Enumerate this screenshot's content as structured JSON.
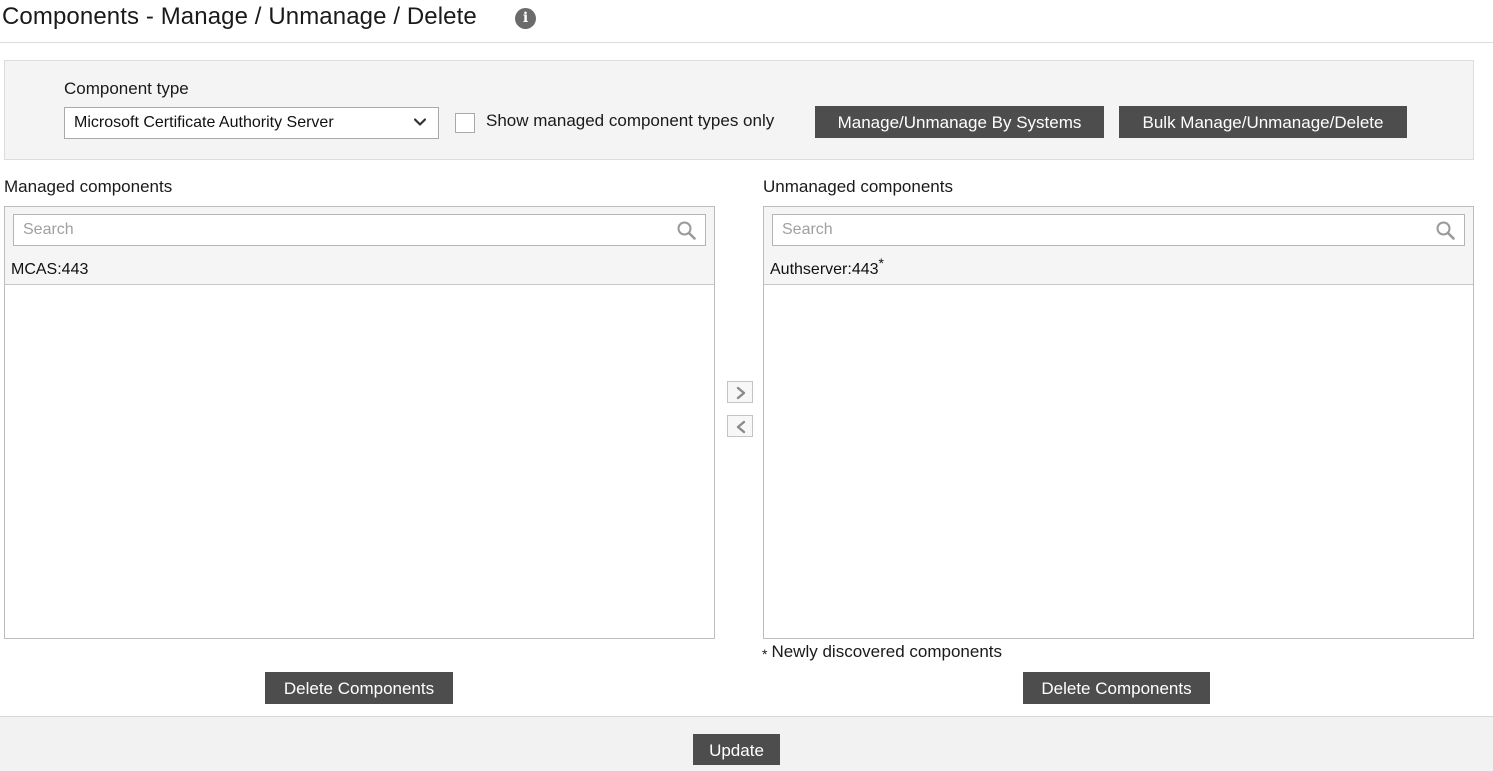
{
  "header": {
    "title": "Components - Manage / Unmanage / Delete",
    "info_icon": "info-circle-icon"
  },
  "filter": {
    "component_type_label": "Component type",
    "component_type_value": "Microsoft Certificate Authority Server",
    "show_managed_only_label": "Show managed component types only",
    "show_managed_only_checked": false,
    "manage_by_systems_label": "Manage/Unmanage By Systems",
    "bulk_label": "Bulk Manage/Unmanage/Delete"
  },
  "managed": {
    "heading": "Managed components",
    "search_placeholder": "Search",
    "items": [
      "MCAS:443"
    ],
    "delete_label": "Delete Components"
  },
  "unmanaged": {
    "heading": "Unmanaged components",
    "search_placeholder": "Search",
    "items": [
      {
        "name": "Authserver:443",
        "marker": "*"
      }
    ],
    "note_marker": "*",
    "note_text": "Newly discovered components",
    "delete_label": "Delete Components"
  },
  "footer": {
    "update_label": "Update"
  },
  "colors": {
    "button_bg": "#4d4d4d",
    "panel_bg": "#f4f4f4"
  }
}
